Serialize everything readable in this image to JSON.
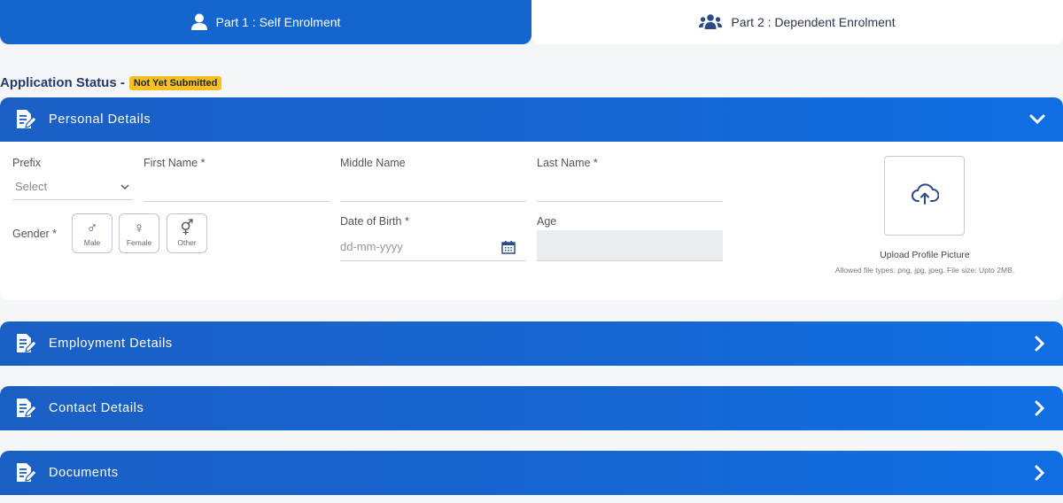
{
  "tabs": [
    {
      "label": "Part 1 : Self Enrolment",
      "icon": "user-icon",
      "active": true
    },
    {
      "label": "Part 2 : Dependent Enrolment",
      "icon": "users-group-icon",
      "active": false
    }
  ],
  "status": {
    "label": "Application Status -",
    "badge": "Not Yet Submitted",
    "badge_color": "#f6c023"
  },
  "sections": [
    {
      "title": "Personal Details",
      "icon": "document-edit-icon",
      "expanded": true,
      "chevron": "chevron-down-icon"
    },
    {
      "title": "Employment Details",
      "icon": "document-edit-icon",
      "expanded": false,
      "chevron": "chevron-right-icon"
    },
    {
      "title": "Contact Details",
      "icon": "document-edit-icon",
      "expanded": false,
      "chevron": "chevron-right-icon"
    },
    {
      "title": "Documents",
      "icon": "document-edit-icon",
      "expanded": false,
      "chevron": "chevron-right-icon"
    }
  ],
  "personal": {
    "prefix": {
      "label": "Prefix",
      "value": "Select"
    },
    "first_name": {
      "label": "First Name *",
      "value": ""
    },
    "middle_name": {
      "label": "Middle Name",
      "value": ""
    },
    "last_name": {
      "label": "Last Name *",
      "value": ""
    },
    "gender": {
      "label": "Gender *",
      "options": [
        {
          "label": "Male",
          "symbol": "♂"
        },
        {
          "label": "Female",
          "symbol": "♀"
        },
        {
          "label": "Other",
          "symbol": "⚥"
        }
      ]
    },
    "dob": {
      "label": "Date of Birth *",
      "placeholder": "dd-mm-yyyy"
    },
    "age": {
      "label": "Age",
      "value": ""
    },
    "upload": {
      "title": "Upload Profile Picture",
      "hint": "Allowed file types: png, jpg, jpeg. File size: Upto 2MB."
    }
  },
  "colors": {
    "primary": "#1565cf",
    "header_text": "#243a6b"
  }
}
